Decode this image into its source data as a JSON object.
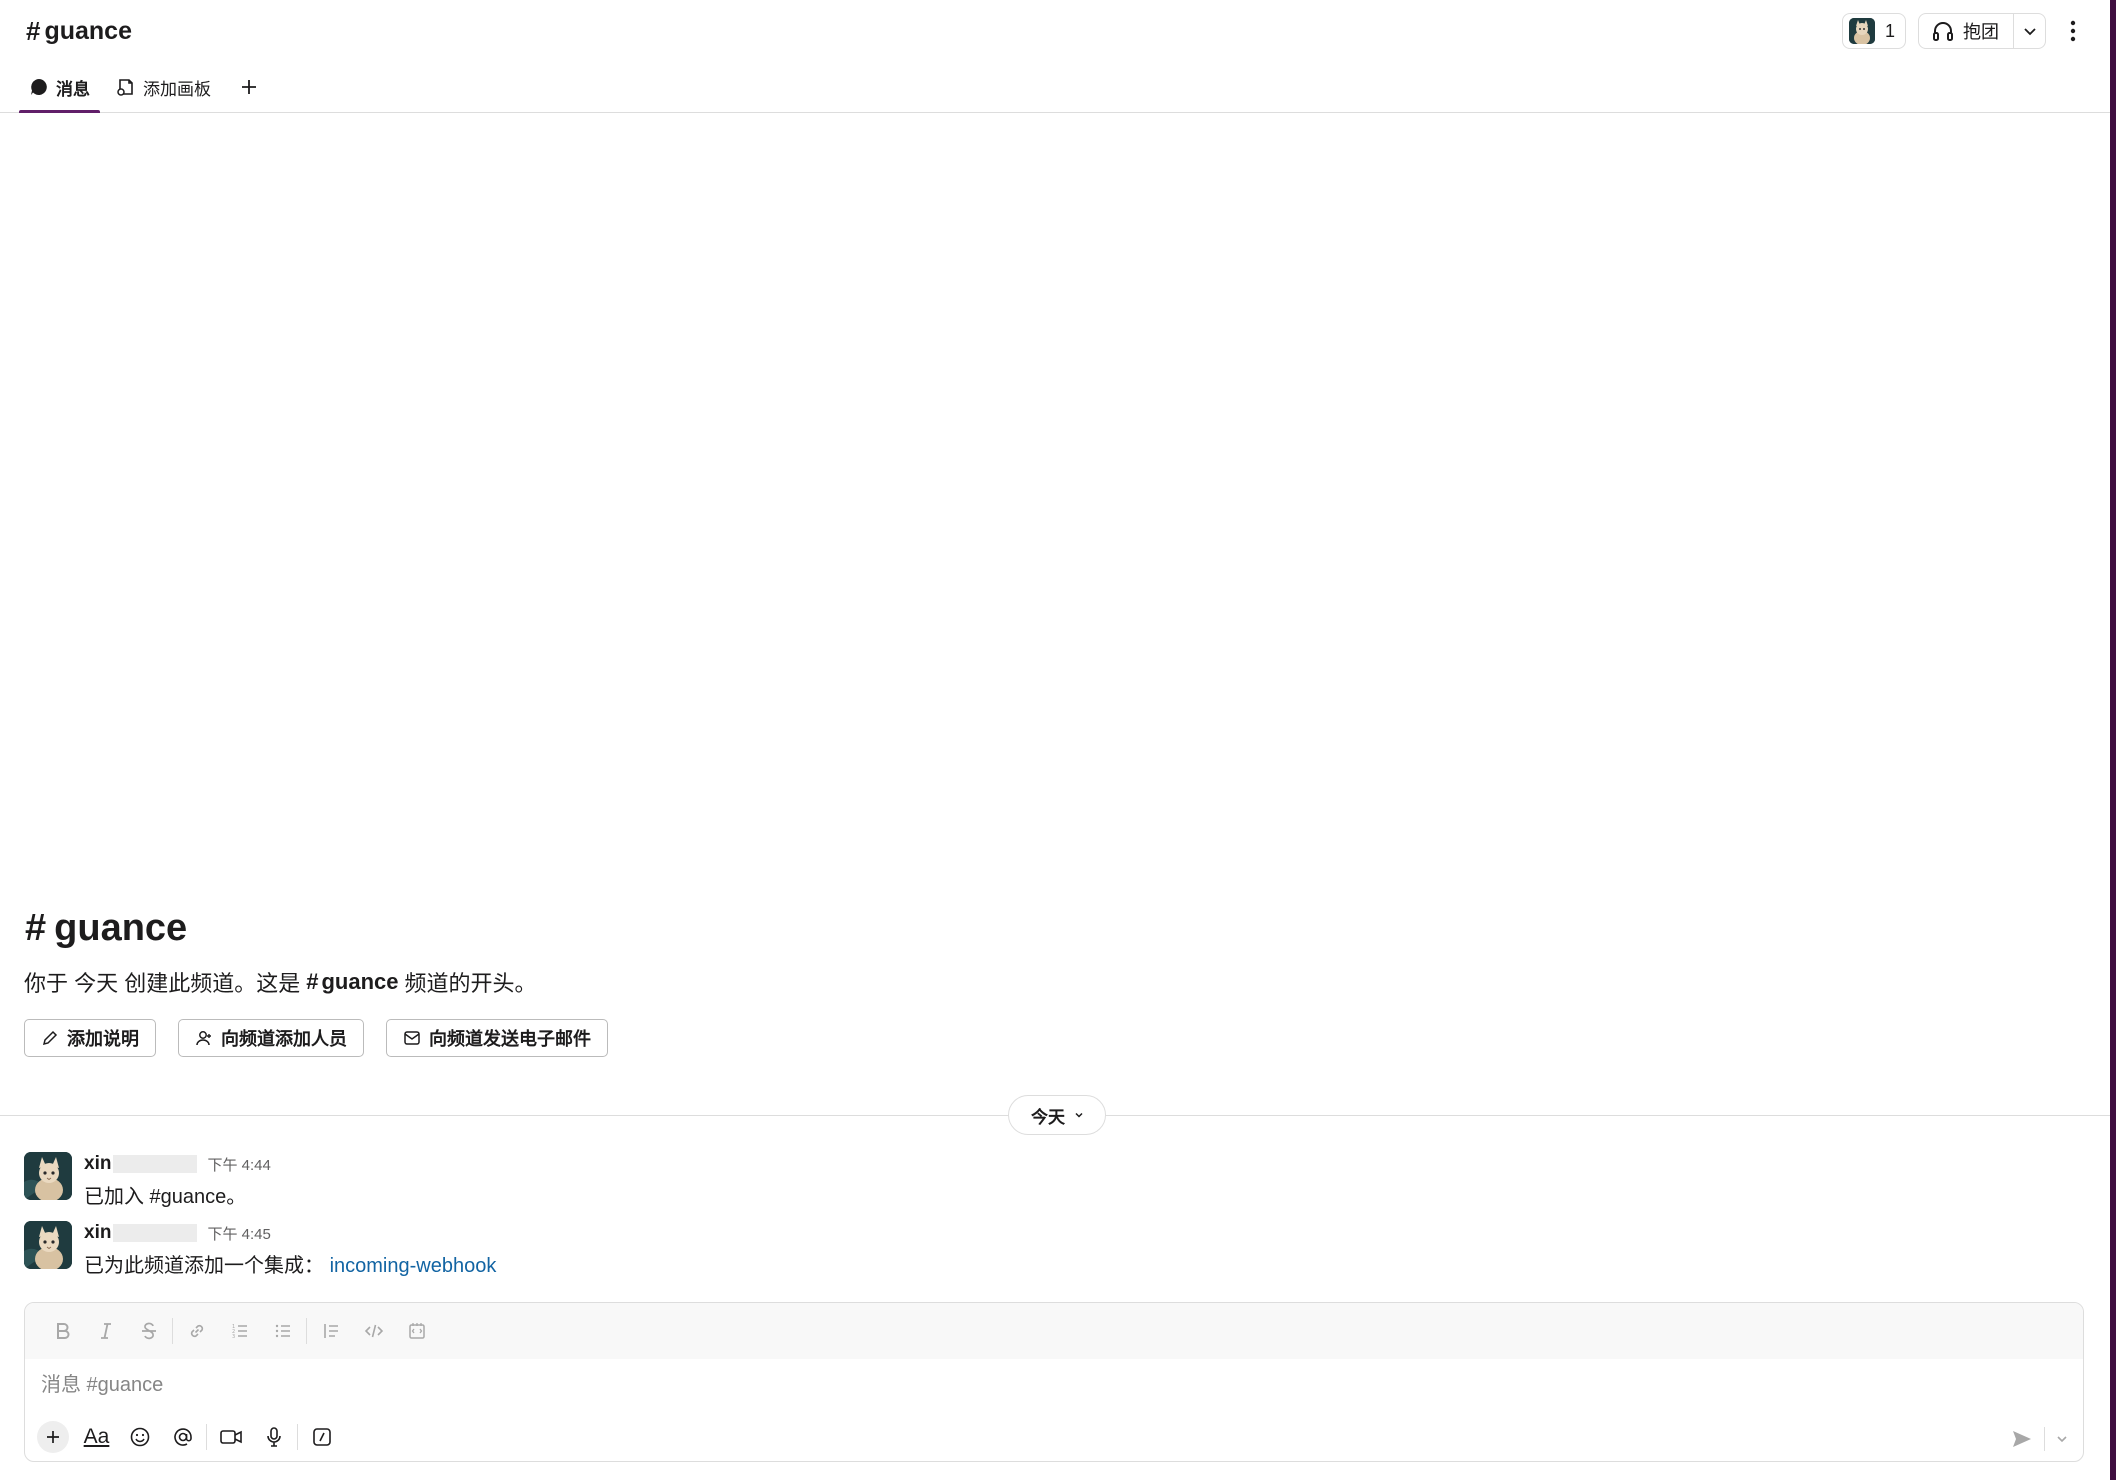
{
  "header": {
    "channel_name": "guance",
    "member_count": "1",
    "huddle_label": "抱团"
  },
  "tabs": [
    {
      "label": "消息",
      "active": true
    },
    {
      "label": "添加画板",
      "active": false
    }
  ],
  "intro": {
    "title": "guance",
    "desc_prefix": "你于 今天 创建此频道。这是",
    "desc_channel": "guance",
    "desc_suffix": "频道的开头。",
    "actions": {
      "add_description": "添加说明",
      "add_people": "向频道添加人员",
      "send_email": "向频道发送电子邮件"
    }
  },
  "divider": {
    "label": "今天"
  },
  "messages": [
    {
      "author": "xin",
      "time": "下午 4:44",
      "text": "已加入 #guance。",
      "link": ""
    },
    {
      "author": "xin",
      "time": "下午 4:45",
      "text": "已为此频道添加一个集成：",
      "link": "incoming-webhook"
    }
  ],
  "composer": {
    "placeholder": "消息 #guance",
    "format_icons": [
      "bold-icon",
      "italic-icon",
      "strikethrough-icon",
      "link-icon",
      "ordered-list-icon",
      "bulleted-list-icon",
      "blockquote-icon",
      "code-icon",
      "code-block-icon"
    ],
    "aa_label": "Aa"
  },
  "colors": {
    "accent": "#611f69",
    "link": "#1264a3",
    "sidebar_edge": "#3f0e40"
  }
}
